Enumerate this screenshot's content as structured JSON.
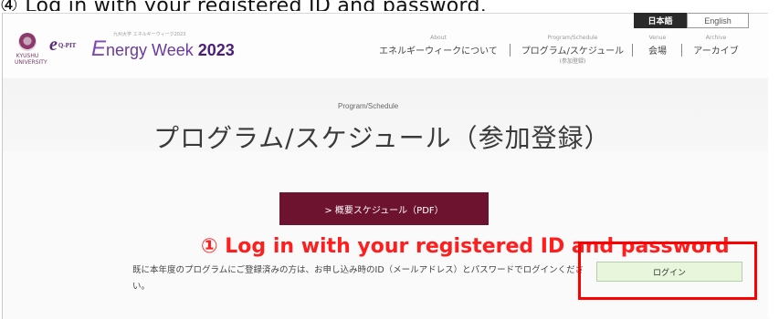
{
  "top_caption": "④ Log in with your registered ID and password.",
  "header": {
    "lang_ja": "日本語",
    "lang_en": "English",
    "logo_university": "KYUSHU UNIVERSITY",
    "logo_eqopit": "Q-PIT",
    "logo_event_small": "九州大学 エネルギーウィーク2023",
    "logo_event": "nergy Week",
    "logo_event_year": "2023",
    "nav": [
      {
        "en": "About",
        "ja": "エネルギーウィークについて",
        "sub": ""
      },
      {
        "en": "Program/Schedule",
        "ja": "プログラム/スケジュール",
        "sub": "(参加登録)"
      },
      {
        "en": "Venue",
        "ja": "会場",
        "sub": ""
      },
      {
        "en": "Archive",
        "ja": "アーカイブ",
        "sub": ""
      }
    ]
  },
  "hero": {
    "label_en": "Program/Schedule",
    "title": "プログラム/スケジュール（参加登録）"
  },
  "pdf_button": "> 概要スケジュール（PDF）",
  "annotation": "① Log in with your registered ID and password",
  "body_text": "既に本年度のプログラムにご登録済みの方は、お申し込み時のID（メールアドレス）とパスワードでログインください。",
  "login_button": "ログイン",
  "colors": {
    "pdf_button_bg": "#6d1330",
    "login_button_bg": "#e8f7dc",
    "annotation_red": "#ff1e1e",
    "brand_purple": "#6b3aa0"
  }
}
